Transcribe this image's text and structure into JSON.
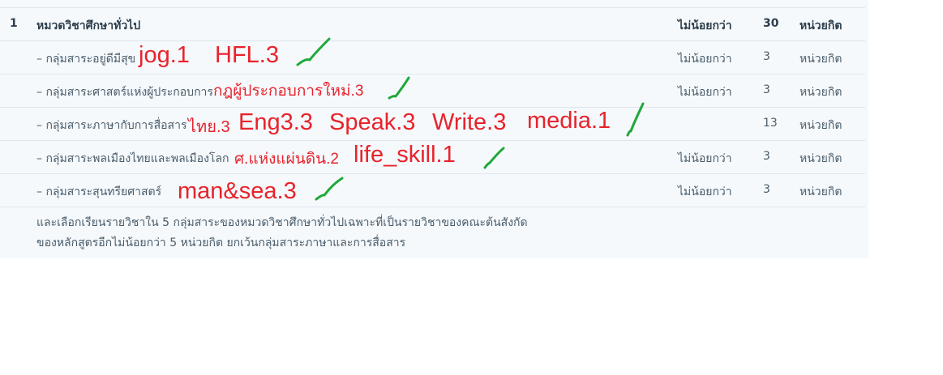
{
  "category": {
    "no": "1",
    "name": "หมวดวิชาศึกษาทั่วไป",
    "condition": "ไม่น้อยกว่า",
    "credits": "30",
    "unit": "หน่วยกิต"
  },
  "groups": [
    {
      "name": "– กลุ่มสาระอยู่ดีมีสุข",
      "condition": "ไม่น้อยกว่า",
      "credits": "3",
      "unit": "หน่วยกิต",
      "notes": [
        "jog.1",
        "HFL.3"
      ]
    },
    {
      "name": "– กลุ่มสาระศาสตร์แห่งผู้ประกอบการ",
      "condition": "ไม่น้อยกว่า",
      "credits": "3",
      "unit": "หน่วยกิต",
      "notes": [
        "กฎผู้ประกอบการใหม่.3"
      ]
    },
    {
      "name": "– กลุ่มสาระภาษากับการสื่อสาร",
      "condition": "",
      "credits": "13",
      "unit": "หน่วยกิต",
      "notes": [
        "ไทย.3",
        "Eng3.3",
        "Speak.3",
        "Write.3",
        "media.1"
      ]
    },
    {
      "name": "– กลุ่มสาระพลเมืองไทยและพลเมืองโลก",
      "condition": "ไม่น้อยกว่า",
      "credits": "3",
      "unit": "หน่วยกิต",
      "notes": [
        "ศ.แห่งแผ่นดิน.2",
        "life_skill.1"
      ]
    },
    {
      "name": "– กลุ่มสาระสุนทรียศาสตร์",
      "condition": "ไม่น้อยกว่า",
      "credits": "3",
      "unit": "หน่วยกิต",
      "notes": [
        "man&sea.3"
      ]
    }
  ],
  "footnote": {
    "line1": "และเลือกเรียนรายวิชาใน 5 กลุ่มสาระของหมวดวิชาศึกษาทั่วไปเฉพาะที่เป็นรายวิชาของคณะต้นสังกัด",
    "line2": "ของหลักสูตรอีกไม่น้อยกว่า 5 หน่วยกิต ยกเว้นกลุ่มสาระภาษาและการสื่อสาร"
  },
  "colors": {
    "annotation_text": "#e8232b",
    "checkmark": "#1fa83a"
  },
  "icons": [
    "checkmark-icon"
  ]
}
